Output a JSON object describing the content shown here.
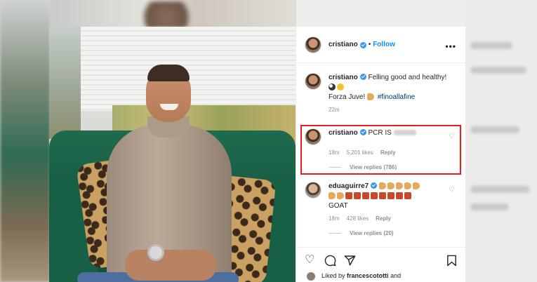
{
  "header": {
    "username": "cristiano",
    "separator": "•",
    "follow_label": "Follow",
    "more": "•••"
  },
  "caption": {
    "username": "cristiano",
    "text_line1": "Felling good and healthy!",
    "text_line2": "Forza Juve!",
    "hashtag": "#finoallafine",
    "time": "22m"
  },
  "comment1": {
    "username": "cristiano",
    "text": "PCR IS",
    "time": "18m",
    "likes": "5,201 likes",
    "reply_label": "Reply",
    "view_replies": "View replies (786)"
  },
  "comment2": {
    "username": "eduaguirre7",
    "text": "GOAT",
    "time": "18m",
    "likes": "428 likes",
    "reply_label": "Reply",
    "view_replies": "View replies (20)"
  },
  "actions": {
    "liked_by_prefix": "Liked by",
    "liked_by_user": "francescototti",
    "liked_by_suffix": "and"
  },
  "icons": {
    "heart": "heart-icon",
    "comment": "comment-icon",
    "share": "share-icon",
    "save": "bookmark-icon",
    "verified": "verified-badge-icon"
  },
  "colors": {
    "follow_blue": "#0095f6",
    "verified_blue": "#3897f0",
    "highlight_red": "#e02121",
    "hashtag": "#00376b"
  }
}
